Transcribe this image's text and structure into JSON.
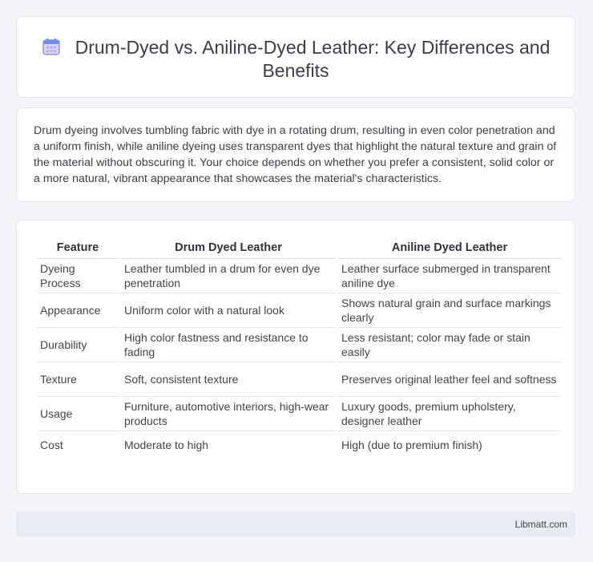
{
  "header": {
    "icon": "calendar-icon",
    "title": "Drum-Dyed vs. Aniline-Dyed Leather: Key Differences and Benefits"
  },
  "intro": "Drum dyeing involves tumbling fabric with dye in a rotating drum, resulting in even color penetration and a uniform finish, while aniline dyeing uses transparent dyes that highlight the natural texture and grain of the material without obscuring it. Your choice depends on whether you prefer a consistent, solid color or a more natural, vibrant appearance that showcases the material's characteristics.",
  "table": {
    "headers": [
      "Feature",
      "Drum Dyed Leather",
      "Aniline Dyed Leather"
    ],
    "rows": [
      [
        "Dyeing Process",
        "Leather tumbled in a drum for even dye penetration",
        "Leather surface submerged in transparent aniline dye"
      ],
      [
        "Appearance",
        "Uniform color with a natural look",
        "Shows natural grain and surface markings clearly"
      ],
      [
        "Durability",
        "High color fastness and resistance to fading",
        "Less resistant; color may fade or stain easily"
      ],
      [
        "Texture",
        "Soft, consistent texture",
        "Preserves original leather feel and softness"
      ],
      [
        "Usage",
        "Furniture, automotive interiors, high-wear products",
        "Luxury goods, premium upholstery, designer leather"
      ],
      [
        "Cost",
        "Moderate to high",
        "High (due to premium finish)"
      ]
    ]
  },
  "footer": {
    "brand": "Libmatt.com"
  }
}
